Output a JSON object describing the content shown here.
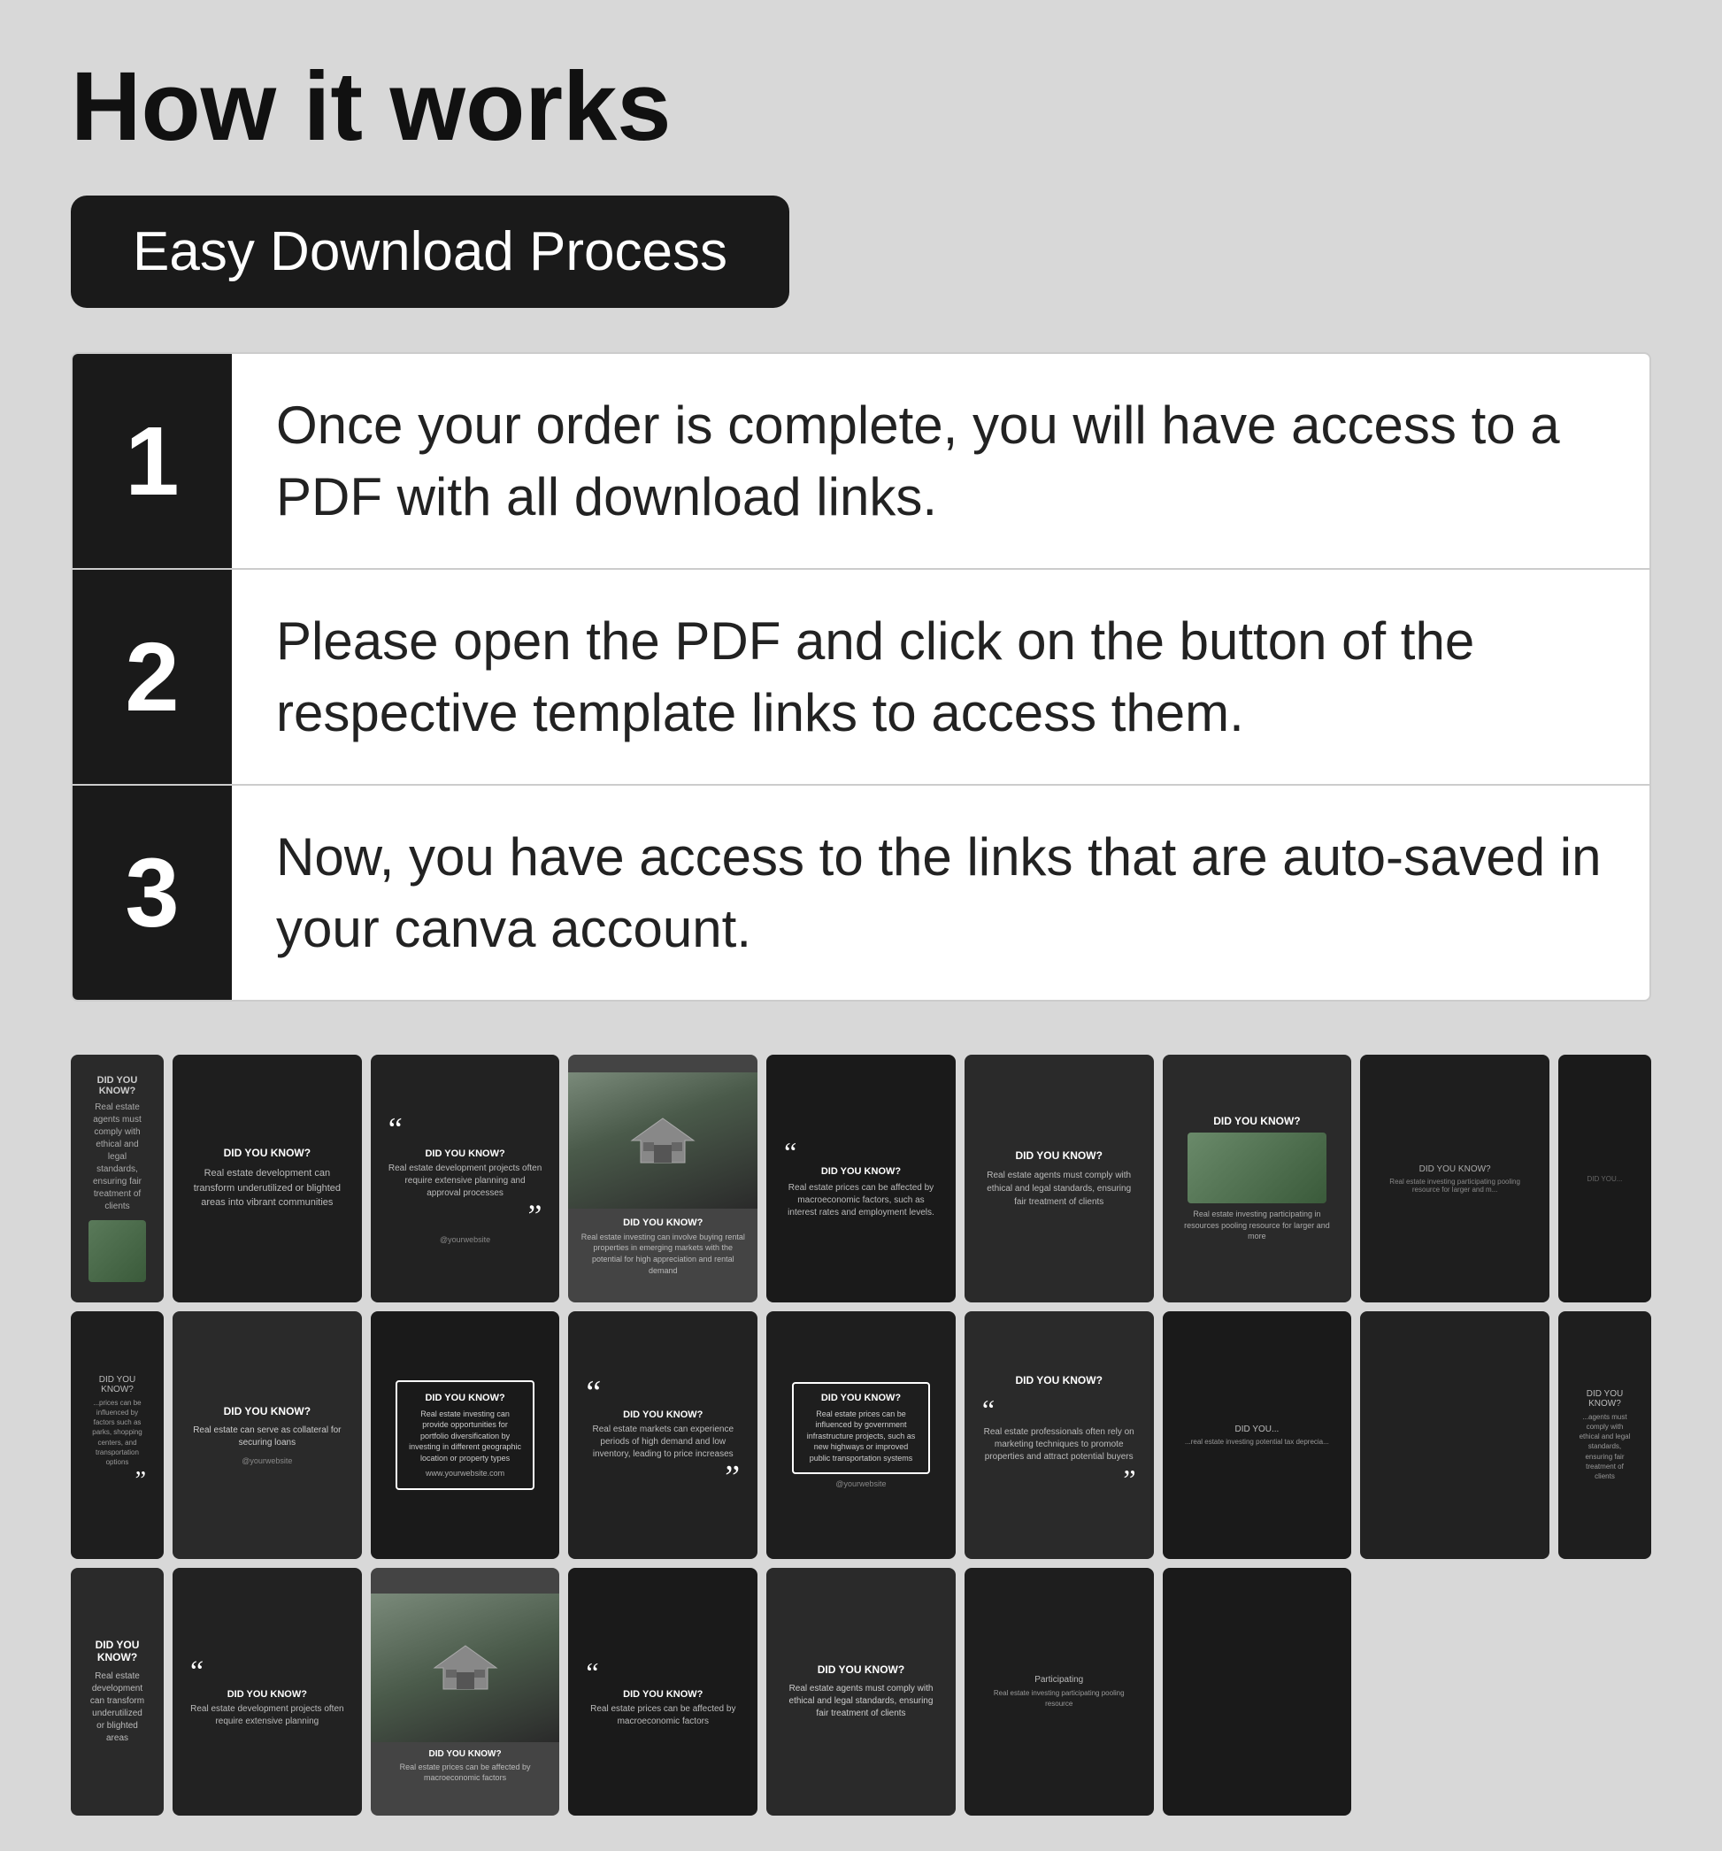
{
  "header": {
    "title": "How it works",
    "tab_label": "Easy Download Process"
  },
  "steps": [
    {
      "number": "1",
      "text": "Once your order is complete, you will have access to a PDF with all download links."
    },
    {
      "number": "2",
      "text": "Please open the PDF and click on the button of the respective template links to access them."
    },
    {
      "number": "3",
      "text": "Now, you have access to the links that are auto-saved in your canva account."
    }
  ],
  "gallery": {
    "cards": [
      {
        "id": 1,
        "type": "did_you_know",
        "headline": "DID YOU KNOW?",
        "text": "Real estate agents must comply with ethical and legal standards, ensuring fair treatment of clients",
        "has_image": true,
        "image_position": "bottom"
      },
      {
        "id": 2,
        "type": "did_you_know",
        "headline": "DID YOU KNOW?",
        "text": "Real estate development can transform underutilized or blighted areas into vibrant communities",
        "has_image": false
      },
      {
        "id": 3,
        "type": "quote",
        "headline": "DID YOU KNOW?",
        "text": "Real estate development projects often require extensive planning and approval processes",
        "has_image": false
      },
      {
        "id": 4,
        "type": "has_image",
        "headline": "DID YOU KNOW?",
        "text": "Real estate investing can involve buying rental properties in emerging markets with the potential for high appreciation and rental demand",
        "has_image": true
      },
      {
        "id": 5,
        "type": "quote_plain",
        "headline": "DID YOU KNOW?",
        "text": "Real estate prices can be affected by macroeconomic factors, such as interest rates and employment levels.",
        "has_image": false
      },
      {
        "id": 6,
        "type": "did_you_know",
        "headline": "DID YOU KNOW?",
        "text": "Real estate agents must comply with ethical and legal standards, ensuring fair treatment of clients",
        "has_image": false
      },
      {
        "id": 7,
        "type": "did_you_know",
        "headline": "DID YOU KNOW?",
        "text": "Real estate investing participating in resources pooling resource for larger and more",
        "has_image": true,
        "partial": "right"
      },
      {
        "id": 8,
        "type": "did_you_know",
        "headline": "DID YOU KNOW?",
        "text": "Real estate prices can be influenced by factors such as parks, shopping centers, and transportation options",
        "has_image": false,
        "partial": "left"
      },
      {
        "id": 9,
        "type": "did_you_know",
        "headline": "DID YOU KNOW?",
        "text": "Real estate investing can provide opportunities for portfolio diversification by investing in different geographic location or property types",
        "website": "www.yourwebsite.com",
        "has_image": false
      },
      {
        "id": 10,
        "type": "quote",
        "headline": "DID YOU KNOW?",
        "text": "Real estate markets can experience periods of high demand and low inventory, leading to price increases",
        "has_image": false
      },
      {
        "id": 11,
        "type": "did_you_know_box",
        "headline": "DID YOU KNOW?",
        "text": "Real estate prices can be influenced by government infrastructure projects, such as new highways or improved public transportation systems",
        "has_image": false
      },
      {
        "id": 12,
        "type": "did_you_know",
        "headline": "DID YOU KNOW?",
        "text": "Real estate professionals often rely on marketing techniques to promote properties and attract potential buyers",
        "has_image": false
      },
      {
        "id": 13,
        "type": "did_you_know",
        "headline": "DID YOU KNOW?",
        "text": "Real estate agents must comply with ethical and legal standards, ensuring fair treatment of clients",
        "has_image": false,
        "partial": "left"
      },
      {
        "id": 14,
        "type": "did_you_know",
        "headline": "DID YOU KNOW?",
        "text": "Real estate development can transform underutilized or blighted areas",
        "has_image": false
      },
      {
        "id": 15,
        "type": "quote",
        "headline": "DID YOU KNOW?",
        "text": "Real estate development projects often require extensive planning",
        "has_image": false
      },
      {
        "id": 16,
        "type": "has_image",
        "headline": "DID YOU KNOW?",
        "text": "Real estate prices can be affected",
        "has_image": true
      },
      {
        "id": 17,
        "type": "quote_plain",
        "headline": "DID YOU KNOW?",
        "text": "Real estate prices can be affected by macroeconomic factors",
        "has_image": false
      },
      {
        "id": 18,
        "type": "did_you_know",
        "headline": "DID YOU KNOW?",
        "text": "Real estate agents must comply with ethical and legal standards",
        "has_image": false
      },
      {
        "id": 19,
        "type": "did_you_know",
        "headline": "Participating",
        "text": "Real estate investing participating pooling resource",
        "has_image": false,
        "partial": "right"
      }
    ]
  }
}
